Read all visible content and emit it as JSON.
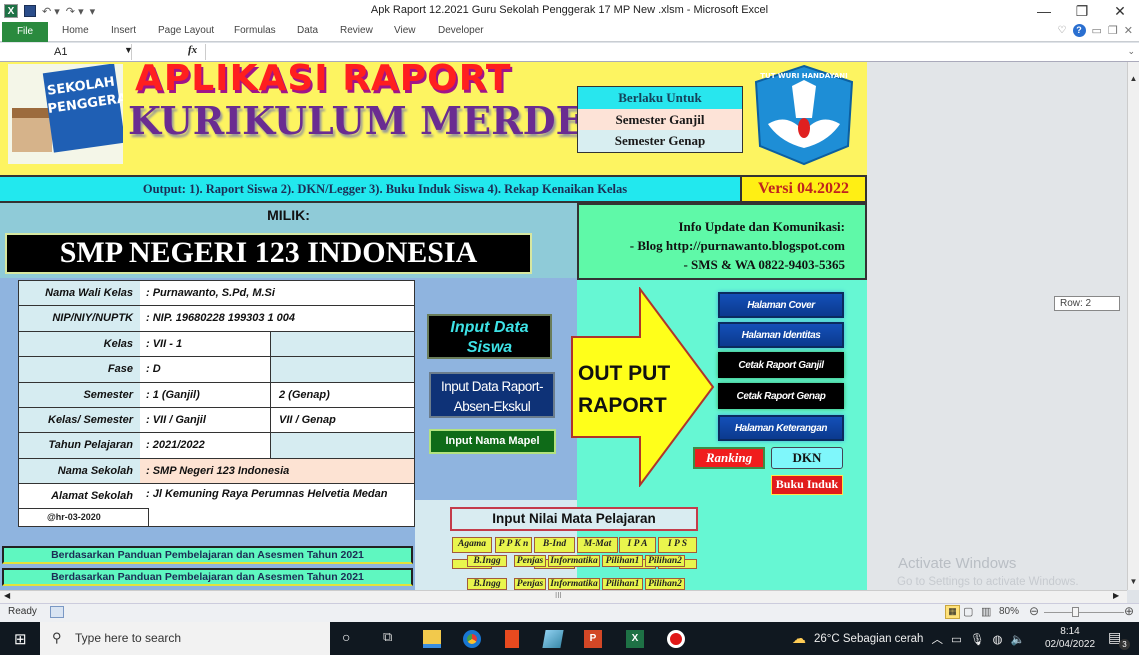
{
  "window": {
    "title": "Apk Raport 12.2021 Guru Sekolah Penggerak 17 MP New  .xlsm  -  Microsoft Excel",
    "controls": {
      "minimize": "—",
      "restore": "❐",
      "close": "✕"
    }
  },
  "ribbon": {
    "file": "File",
    "tabs": [
      "Home",
      "Insert",
      "Page Layout",
      "Formulas",
      "Data",
      "Review",
      "View",
      "Developer"
    ]
  },
  "formula_bar": {
    "name_box": "A1",
    "fx": "fx",
    "value": ""
  },
  "header": {
    "logo_text_line1": "SEKOLAH",
    "logo_text_line2": "PENGGERAK",
    "title_line1": "APLIKASI RAPORT",
    "title_line2": "KURIKULUM MERDEKA",
    "semester_box": [
      "Berlaku Untuk",
      "Semester Ganjil",
      "Semester Genap"
    ],
    "emblem_text": "TUTWURI HANDAYANI"
  },
  "output_band": {
    "text": "Output: 1). Raport Siswa   2). DKN/Legger     3). Buku Induk Siswa   4). Rekap Kenaikan Kelas",
    "version": "Versi 04.2022"
  },
  "owner": {
    "label": "MILIK:",
    "school_name": "SMP NEGERI 123 INDONESIA"
  },
  "info": {
    "line1": "Info Update dan Komunikasi:",
    "line2": "- Blog http://purnawanto.blogspot.com",
    "line3": "- SMS & WA 0822-9403-5365"
  },
  "identity": {
    "rows": [
      {
        "label": "Nama Wali Kelas",
        "value": ": Purnawanto, S.Pd, M.Si",
        "value2": null
      },
      {
        "label": "NIP/NIY/NUPTK",
        "value": ": NIP. 19680228 199303 1 004",
        "value2": null
      },
      {
        "label": "Kelas",
        "value": ":   VII - 1",
        "value2": ""
      },
      {
        "label": "Fase",
        "value": ":   D",
        "value2": ""
      },
      {
        "label": "Semester",
        "value": ":   1 (Ganjil)",
        "value2": "2 (Genap)"
      },
      {
        "label": "Kelas/ Semester",
        "value": ":   VII / Ganjil",
        "value2": "VII / Genap"
      },
      {
        "label": "Tahun Pelajaran",
        "value": ":   2021/2022",
        "value2": ""
      },
      {
        "label": "Nama Sekolah",
        "value": ": SMP Negeri 123 Indonesia",
        "value2": null
      },
      {
        "label": "Alamat Sekolah",
        "value": ": Jl Kemuning Raya Perumnas Helvetia Medan",
        "value2": null
      }
    ],
    "copyright": "@hr-03-2020"
  },
  "buttons": {
    "input_siswa": "Input Data Siswa",
    "input_raport": "Input Data Raport-Absen-Ekskul",
    "input_mapel": "Input  Nama Mapel",
    "output_arrow": "OUT PUT RAPORT",
    "halaman_cover": "Halaman Cover",
    "halaman_identitas": "Halaman Identitas",
    "cetak_ganjil": "Cetak Raport Ganjil",
    "cetak_genap": "Cetak Raport Genap",
    "halaman_keterangan": "Halaman Keterangan",
    "ranking": "Ranking",
    "dkn": "DKN",
    "buku_induk": "Buku Induk"
  },
  "nilai": {
    "heading": "Input Nilai Mata Pelajaran",
    "row1": [
      "Agama",
      "P P K n",
      "B-Ind",
      "M-Mat",
      "I P A",
      "I P S"
    ],
    "row2": [
      "B.Ingg",
      "Penjas",
      "Informatika",
      "Pilihan1",
      "Pilihan2"
    ]
  },
  "footer_bands": [
    "Berdasarkan Panduan Pembelajaran dan Asesmen Tahun 2021",
    "Berdasarkan Panduan Pembelajaran dan Asesmen Tahun 2021"
  ],
  "row_tooltip": "Row: 2",
  "watermark": {
    "line1": "Activate Windows",
    "line2": "Go to Settings to activate Windows."
  },
  "status": {
    "ready": "Ready",
    "zoom": "80%"
  },
  "taskbar": {
    "search_placeholder": "Type here to search",
    "weather": "26°C  Sebagian cerah",
    "time": "8:14",
    "date": "02/04/2022",
    "notifications": "3"
  }
}
